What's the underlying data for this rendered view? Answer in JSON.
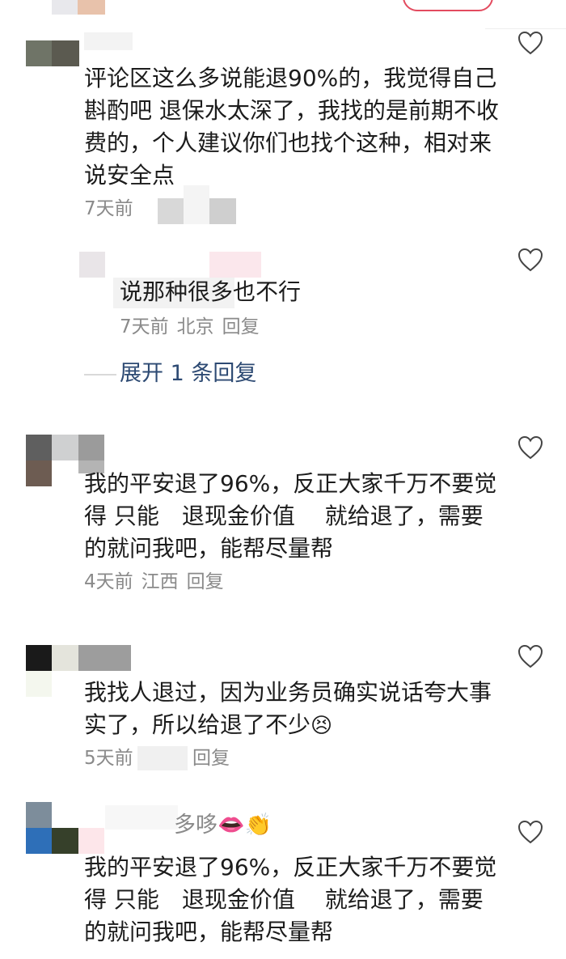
{
  "comments": [
    {
      "text": "评论区这么多说能退90%的，我觉得自己斟酌吧 退保水太深了，我找的是前期不收费的，个人建议你们也找个这种，相对来说安全点",
      "time": "7天前"
    },
    {
      "reply_text": "说那种很多也不行",
      "time": "7天前",
      "location": "北京",
      "reply_label": "回复",
      "expand_label": "展开 1 条回复"
    },
    {
      "text": "我的平安退了96%，反正大家千万不要觉得 只能　退现金价值　 就给退了，需要的就问我吧，能帮尽量帮",
      "time": "4天前",
      "location": "江西",
      "reply_label": "回复"
    },
    {
      "text": "我找人退过，因为业务员确实说话夸大事实了，所以给退了不少",
      "time": "5天前",
      "reply_label": "回复",
      "emoji": "😣"
    },
    {
      "username_suffix": "多哆",
      "username_emojis": "👄👏",
      "text": "我的平安退了96%，反正大家千万不要觉得 只能　退现金价值　 就给退了，需要的就问我吧，能帮尽量帮"
    }
  ],
  "icons": {
    "like": "heart-outline-icon"
  },
  "colors": {
    "link": "#2d4a73",
    "meta": "#8a8a8a",
    "accent": "#e34b5f"
  }
}
